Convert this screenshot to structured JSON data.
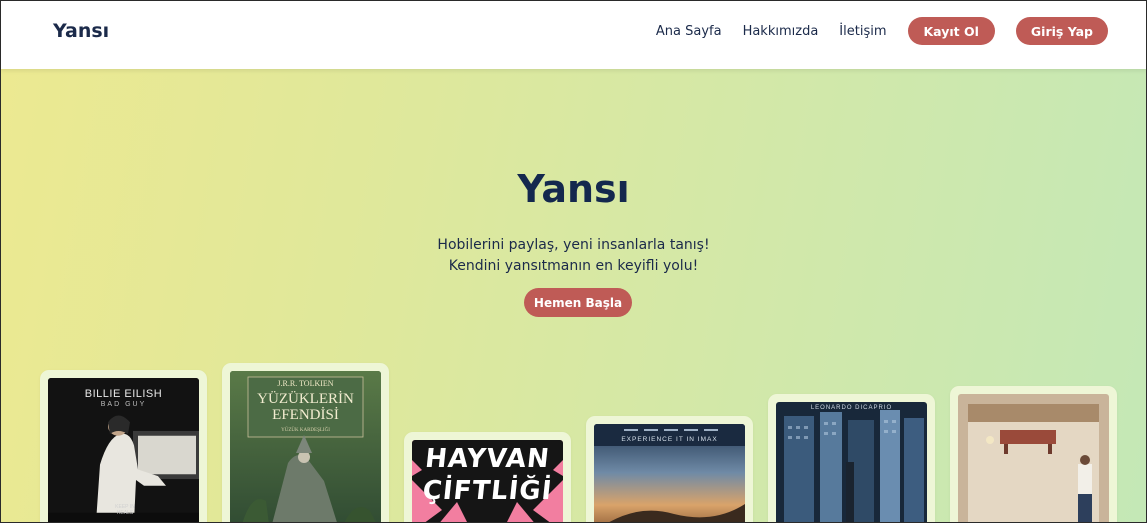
{
  "nav": {
    "brand": "Yansı",
    "links": [
      "Ana Sayfa",
      "Hakkımızda",
      "İletişim"
    ],
    "register": "Kayıt Ol",
    "login": "Giriş Yap"
  },
  "hero": {
    "title": "Yansı",
    "line1": "Hobilerini paylaş, yeni insanlarla tanış!",
    "line2": "Kendini yansıtmanın en keyifli yolu!",
    "cta": "Hemen Başla"
  },
  "covers": {
    "billie": {
      "artist": "BILLIE EILISH",
      "album": "BAD GUY",
      "footer": "KEEP IN HEALS"
    },
    "tolkien": {
      "author": "J.R.R. TOLKIEN",
      "title1": "YÜZÜKLERİN",
      "title2": "EFENDİSİ",
      "credit": "Yüzük Kardeşliği"
    },
    "animal": {
      "title1": "HAYVAN",
      "title2": "ÇİFTLİĞİ"
    },
    "imax": {
      "tagline": "EXPERIENCE IT IN IMAX"
    },
    "leo": {
      "actor": "LEONARDO DICAPRIO"
    },
    "room": {}
  },
  "colors": {
    "accent": "#bf5b56",
    "navy": "#14284e",
    "gradient_start": "#ece991",
    "gradient_end": "#c4e8b6"
  }
}
